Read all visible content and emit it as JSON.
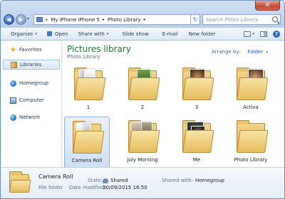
{
  "window": {
    "close_glyph": "✕",
    "nav": {
      "back_glyph": "◀",
      "forward_glyph": "▶",
      "dropdown_glyph": "▾"
    },
    "address": {
      "overflow_glyph": "«",
      "segments": [
        "My iPhone iPhone 5",
        "Photo Library"
      ],
      "separator": "▸",
      "dropdown_glyph": "▾",
      "refresh_glyph": "↻"
    },
    "search": {
      "placeholder": "Search Photo Library"
    }
  },
  "toolbar": {
    "organize": "Organize",
    "open": "Open",
    "share_with": "Share with",
    "slide_show": "Slide show",
    "email": "E-mail",
    "new_folder": "New folder",
    "caret": "▾",
    "help_glyph": "?"
  },
  "sidebar": {
    "items": [
      {
        "label": "Favorites",
        "icon": "star-icon"
      },
      {
        "label": "Libraries",
        "icon": "libraries-icon",
        "selected": true
      },
      {
        "label": "Homegroup",
        "icon": "homegroup-icon"
      },
      {
        "label": "Computer",
        "icon": "computer-icon"
      },
      {
        "label": "Network",
        "icon": "network-icon"
      }
    ]
  },
  "library": {
    "title": "Pictures library",
    "subtitle": "Photo Library",
    "arrange_label": "Arrange by:",
    "arrange_value": "Folder"
  },
  "folders": [
    {
      "name": "1"
    },
    {
      "name": "2"
    },
    {
      "name": "3"
    },
    {
      "name": "Activa"
    },
    {
      "name": "Camera Roll",
      "selected": true
    },
    {
      "name": "July Morning"
    },
    {
      "name": "Me"
    },
    {
      "name": "Photo Library"
    }
  ],
  "details": {
    "name": "Camera Roll",
    "type": "File folder",
    "state_label": "State:",
    "state_value": "Shared",
    "shared_label": "Shared with:",
    "shared_value": "Homegroup",
    "modified_label": "Date modified:",
    "modified_value": "30/09/2015 16:50"
  }
}
